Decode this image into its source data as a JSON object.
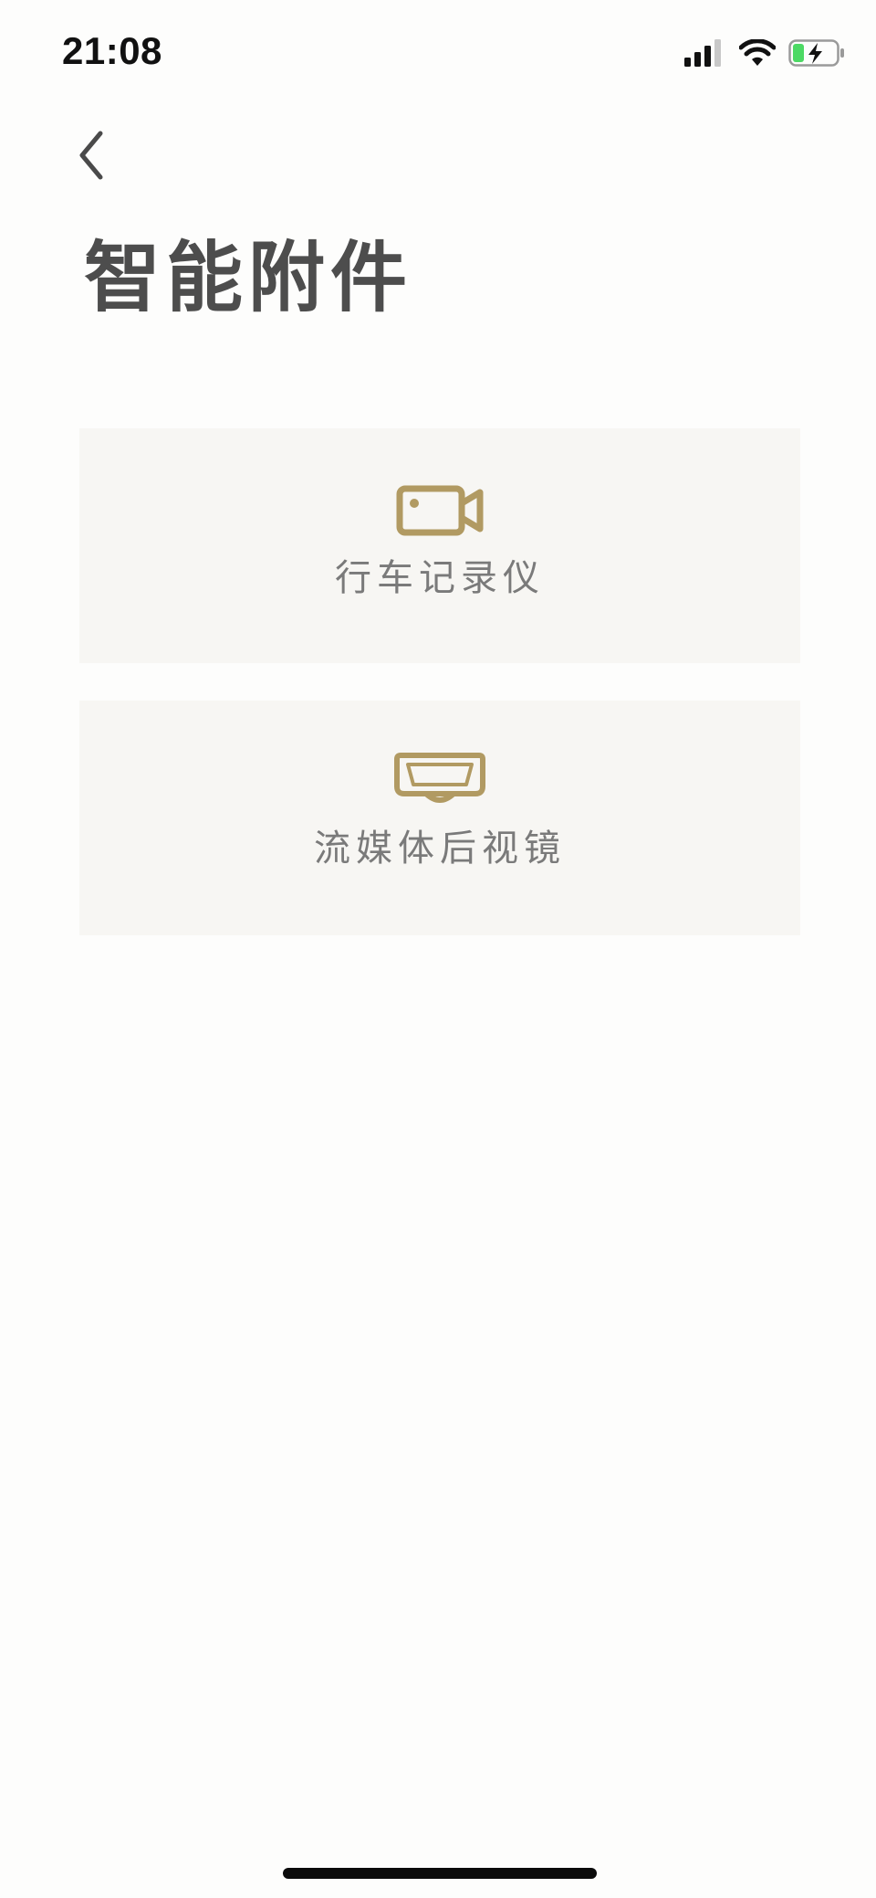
{
  "status_bar": {
    "time": "21:08",
    "icons": [
      "signal-icon",
      "wifi-icon",
      "battery-charging-icon"
    ]
  },
  "header": {
    "back_icon": "chevron-left-icon",
    "title": "智能附件"
  },
  "accessories": [
    {
      "label": "行车记录仪",
      "icon": "video-camera-icon"
    },
    {
      "label": "流媒体后视镜",
      "icon": "rearview-mirror-icon"
    }
  ],
  "colors": {
    "accent": "#b19a62",
    "card_background": "#f7f6f3",
    "title_text": "#4d4d4d",
    "label_text": "#7a7a7a",
    "battery_green": "#4cd964"
  }
}
